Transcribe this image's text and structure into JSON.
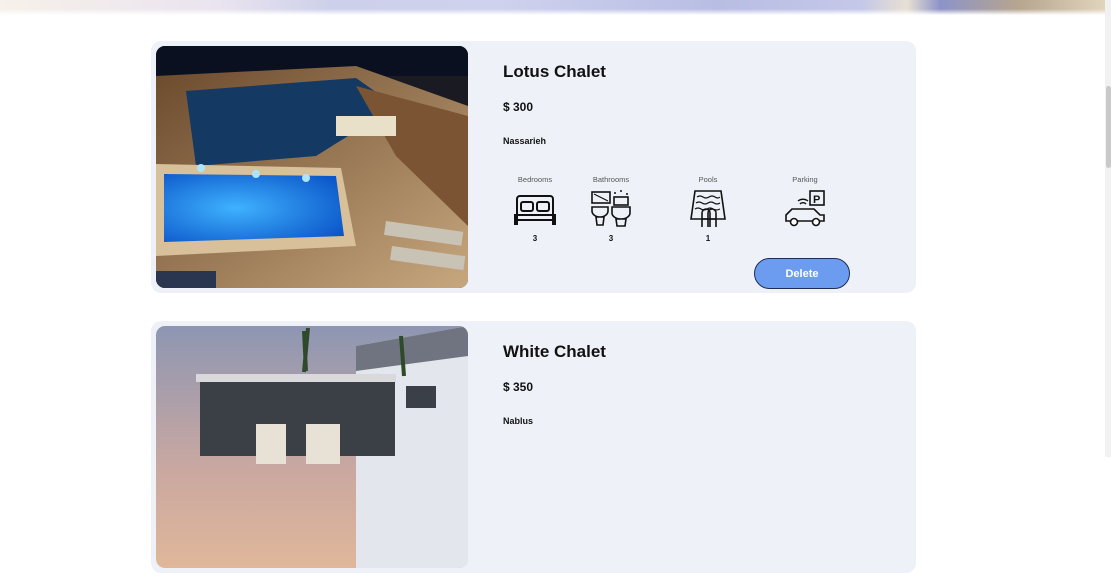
{
  "listings": [
    {
      "title": "Lotus Chalet",
      "price": "$ 300",
      "location": "Nassarieh",
      "amenities": [
        {
          "label": "Bedrooms",
          "value": "3",
          "icon": "bed-icon"
        },
        {
          "label": "Bathrooms",
          "value": "3",
          "icon": "bathroom-icon"
        },
        {
          "label": "Pools",
          "value": "1",
          "icon": "pool-icon"
        },
        {
          "label": "Parking",
          "value": "",
          "icon": "parking-icon"
        }
      ],
      "delete_label": "Delete"
    },
    {
      "title": "White Chalet",
      "price": "$ 350",
      "location": "Nablus"
    }
  ]
}
